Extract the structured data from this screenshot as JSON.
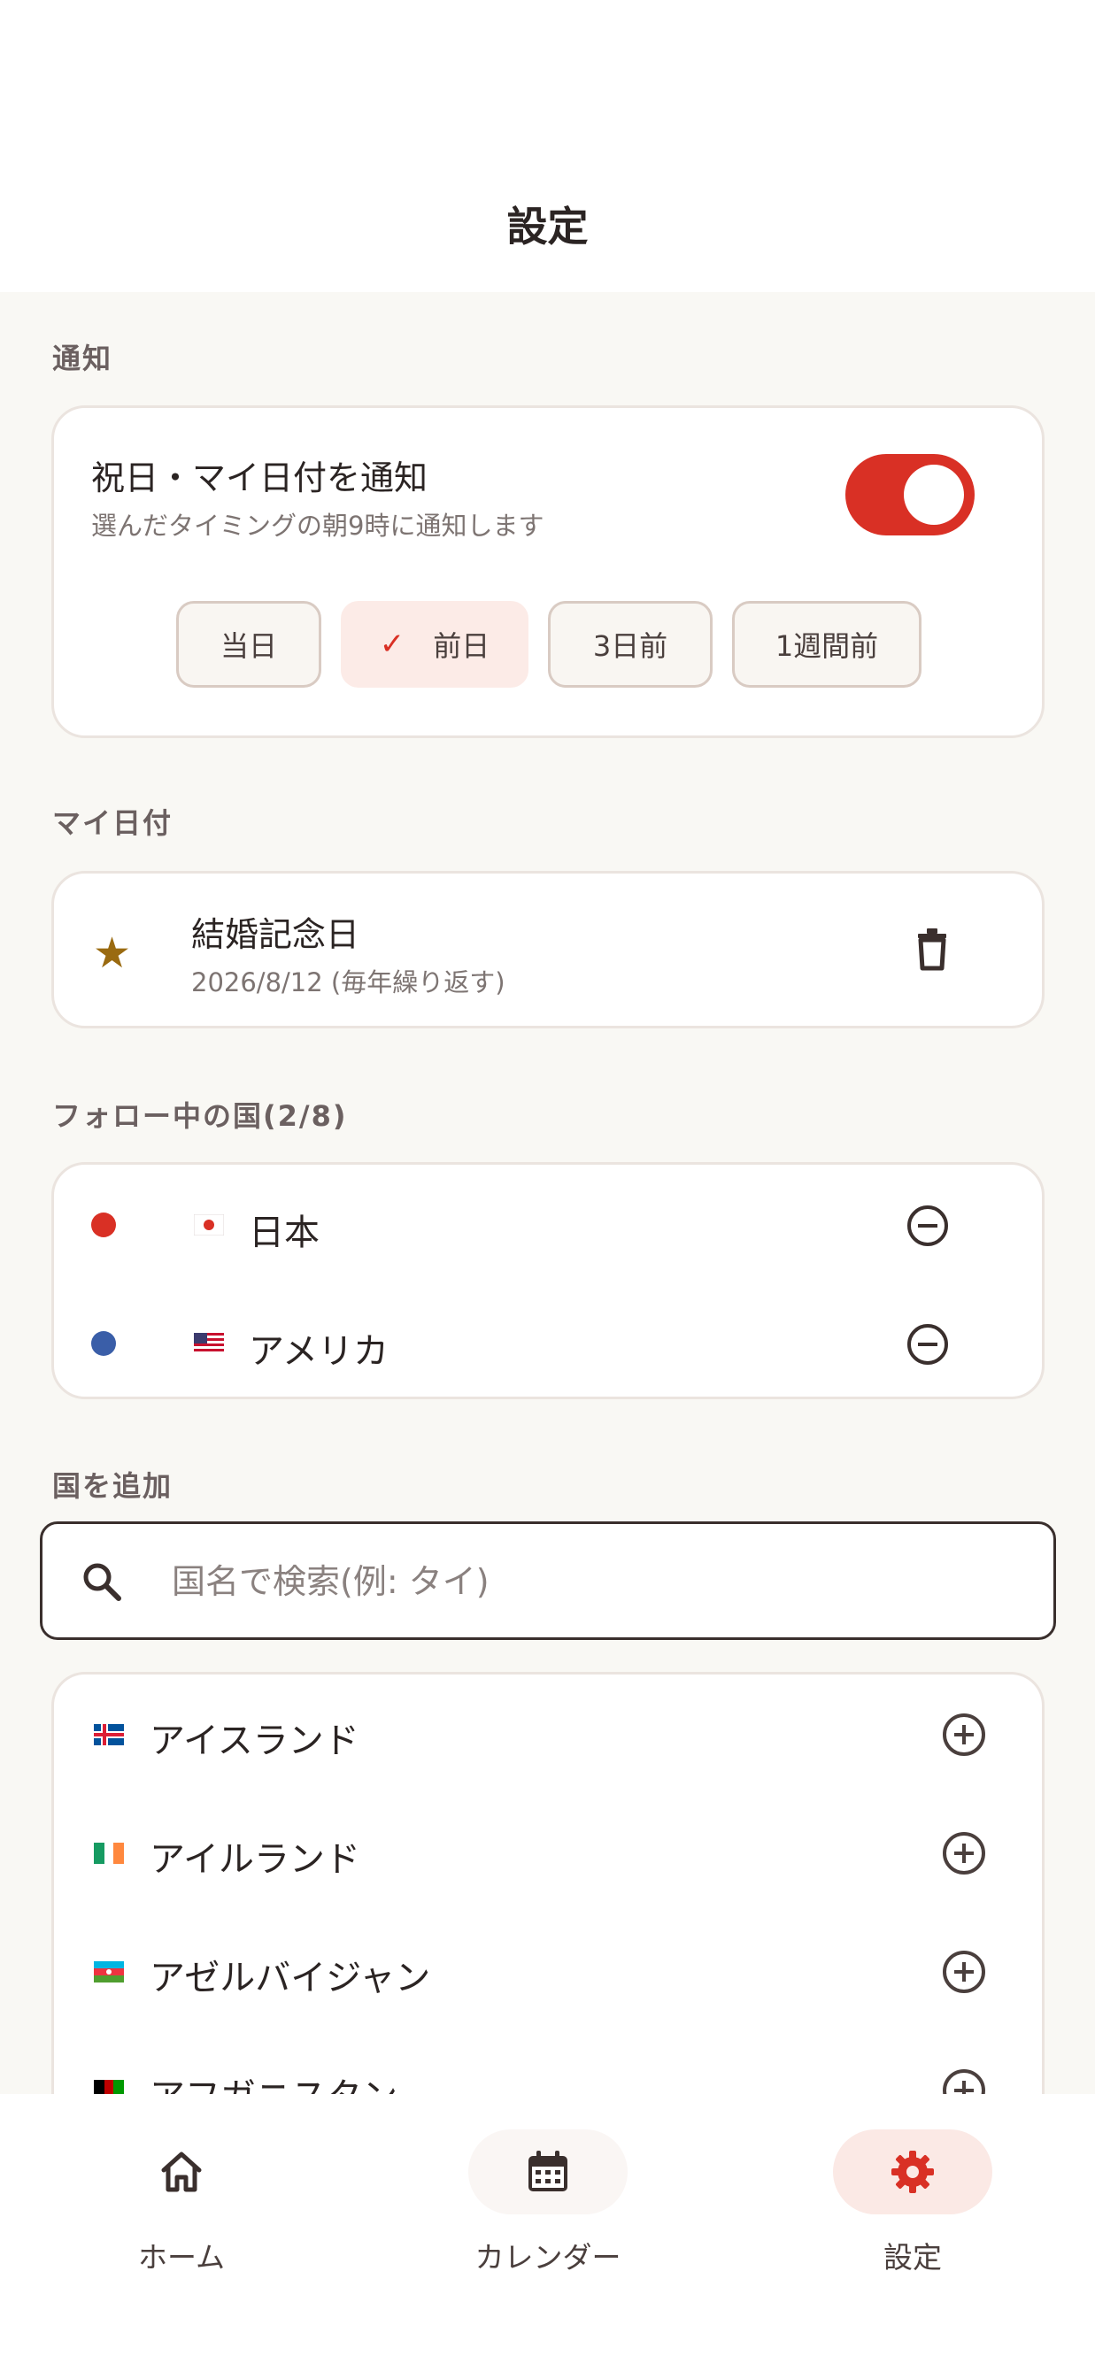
{
  "header": {
    "title": "設定"
  },
  "notifications": {
    "section_label": "通知",
    "title": "祝日・マイ日付を通知",
    "subtitle": "選んだタイミングの朝9時に通知します",
    "toggle_on": true,
    "options": [
      {
        "label": "当日",
        "selected": false
      },
      {
        "label": "前日",
        "selected": true
      },
      {
        "label": "3日前",
        "selected": false
      },
      {
        "label": "1週間前",
        "selected": false
      }
    ]
  },
  "my_dates": {
    "section_label": "マイ日付",
    "items": [
      {
        "title": "結婚記念日",
        "subtitle": "2026/8/12 (毎年繰り返す)",
        "icon": "star-icon"
      }
    ]
  },
  "followed": {
    "section_label": "フォロー中の国(2/8)",
    "items": [
      {
        "name": "日本",
        "flag": "jp-flag-icon",
        "dot_color": "#d93025"
      },
      {
        "name": "アメリカ",
        "flag": "us-flag-icon",
        "dot_color": "#3a5ea8"
      }
    ]
  },
  "add_country": {
    "section_label": "国を追加",
    "search_placeholder": "国名で検索(例: タイ)",
    "items": [
      {
        "name": "アイスランド",
        "flag": "is-flag-icon"
      },
      {
        "name": "アイルランド",
        "flag": "ie-flag-icon"
      },
      {
        "name": "アゼルバイジャン",
        "flag": "az-flag-icon"
      },
      {
        "name": "アフガニスタン",
        "flag": "af-flag-icon"
      }
    ]
  },
  "nav": {
    "items": [
      {
        "label": "ホーム",
        "icon": "home-icon",
        "active": false
      },
      {
        "label": "カレンダー",
        "icon": "calendar-icon",
        "active": false
      },
      {
        "label": "設定",
        "icon": "gear-icon",
        "active": true
      }
    ]
  },
  "colors": {
    "accent": "#d93025",
    "background": "#f9f8f4",
    "text": "#2b2423"
  }
}
